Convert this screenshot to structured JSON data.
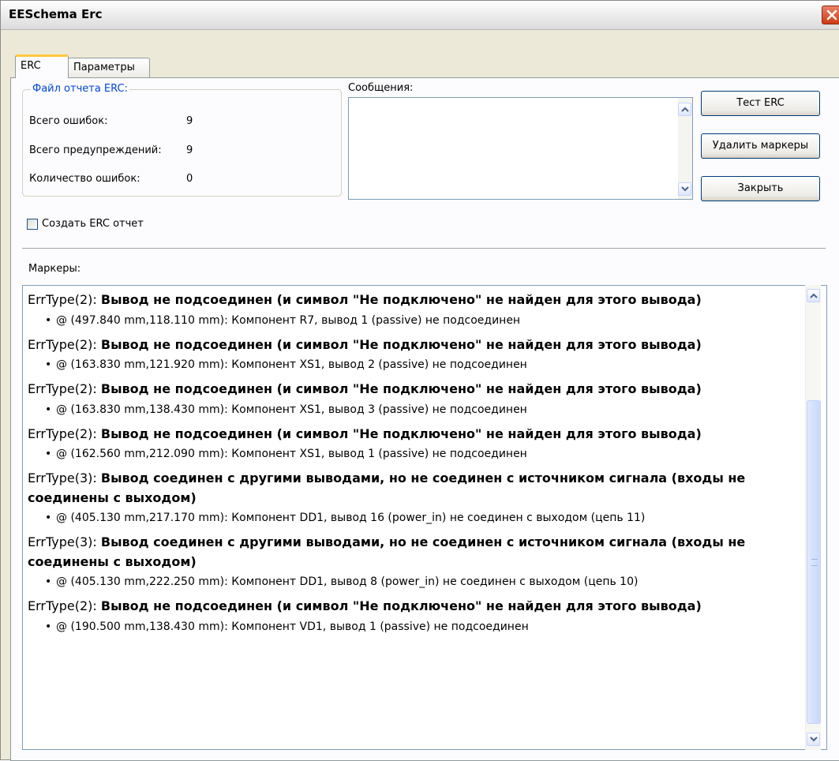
{
  "window": {
    "title": "EESchema Erc"
  },
  "tabs": [
    {
      "label": "ERC"
    },
    {
      "label": "Параметры"
    }
  ],
  "report": {
    "legend": "Файл отчета ERC:",
    "stats": [
      {
        "label": "Всего ошибок:",
        "value": "9"
      },
      {
        "label": "Всего предупреждений:",
        "value": "9"
      },
      {
        "label": "Количество ошибок:",
        "value": "0"
      }
    ]
  },
  "messages": {
    "label": "Сообщения:",
    "value": ""
  },
  "buttons": {
    "test": "Тест ERC",
    "delete_markers": "Удалить маркеры",
    "close": "Закрыть"
  },
  "create_report": {
    "label": "Создать ERC отчет",
    "checked": false
  },
  "markers": {
    "label": "Маркеры:",
    "items": [
      {
        "type": "ErrType(2):",
        "message": "Вывод не подсоединен (и символ \"Не подключено\" не найден для этого вывода)",
        "detail": "@ (497.840 mm,118.110 mm): Компонент R7, вывод 1 (passive) не подсоединен"
      },
      {
        "type": "ErrType(2):",
        "message": "Вывод не подсоединен (и символ \"Не подключено\" не найден для этого вывода)",
        "detail": "@ (163.830 mm,121.920 mm): Компонент XS1, вывод 2 (passive) не подсоединен"
      },
      {
        "type": "ErrType(2):",
        "message": "Вывод не подсоединен (и символ \"Не подключено\" не найден для этого вывода)",
        "detail": "@ (163.830 mm,138.430 mm): Компонент XS1, вывод 3 (passive) не подсоединен"
      },
      {
        "type": "ErrType(2):",
        "message": "Вывод не подсоединен (и символ \"Не подключено\" не найден для этого вывода)",
        "detail": "@ (162.560 mm,212.090 mm): Компонент XS1, вывод 1 (passive) не подсоединен"
      },
      {
        "type": "ErrType(3):",
        "message": "Вывод соединен с другими выводами, но не соединен с источником сигнала (входы не соединены с выходом)",
        "detail": "@ (405.130 mm,217.170 mm): Компонент DD1, вывод 16 (power_in) не соединен с выходом (цепь 11)"
      },
      {
        "type": "ErrType(3):",
        "message": "Вывод соединен с другими выводами, но не соединен с источником сигнала (входы не соединены с выходом)",
        "detail": "@ (405.130 mm,222.250 mm): Компонент DD1, вывод 8 (power_in) не соединен с выходом (цепь 10)"
      },
      {
        "type": "ErrType(2):",
        "message": "Вывод не подсоединен (и символ \"Не подключено\" не найден для этого вывода)",
        "detail": "@ (190.500 mm,138.430 mm): Компонент VD1, вывод 1 (passive) не подсоединен"
      }
    ]
  },
  "colors": {
    "group_legend": "#0046d5",
    "active_tab_accent": "#ffc83c",
    "close_button": "#cc3a14"
  },
  "icons": [
    "close-icon",
    "scroll-up-icon",
    "scroll-down-icon"
  ]
}
